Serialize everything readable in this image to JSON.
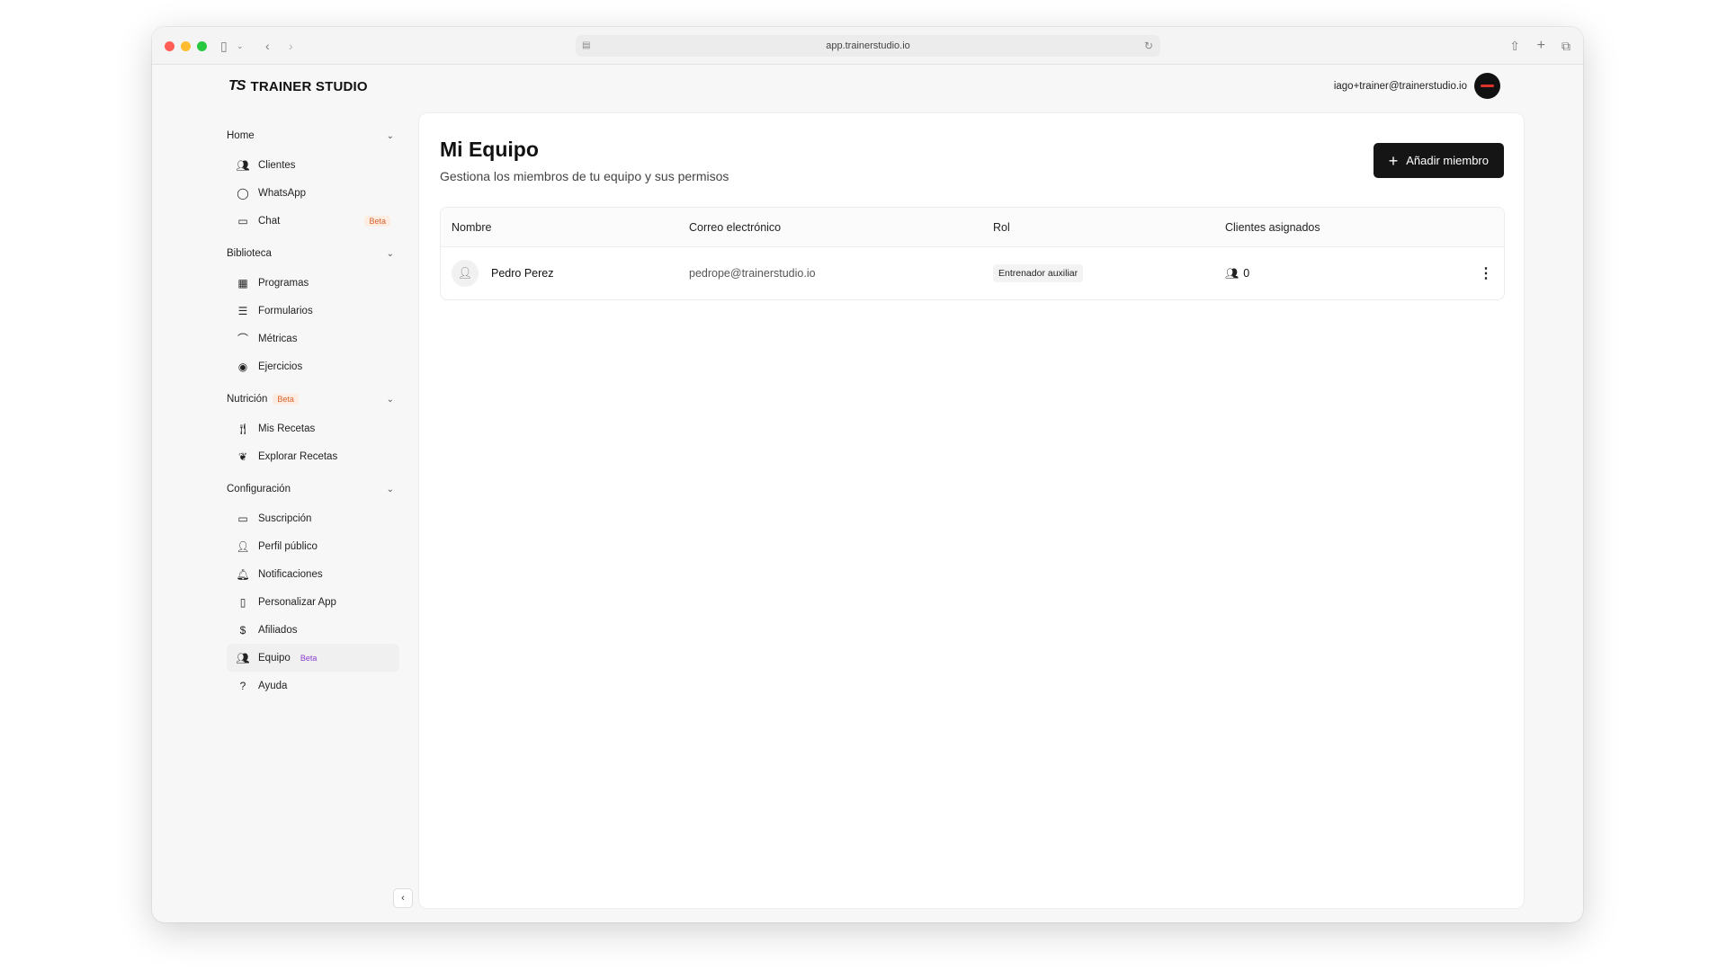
{
  "browser": {
    "url": "app.trainerstudio.io"
  },
  "header": {
    "logo_mark": "TS",
    "logo_text": "TRAINER STUDIO",
    "account_email": "iago+trainer@trainerstudio.io"
  },
  "sidebar": {
    "sections": [
      {
        "title": "Home",
        "items": [
          {
            "label": "Clientes",
            "icon": "users-icon"
          },
          {
            "label": "WhatsApp",
            "icon": "whatsapp-icon"
          },
          {
            "label": "Chat",
            "icon": "chat-icon",
            "badge": "Beta"
          }
        ]
      },
      {
        "title": "Biblioteca",
        "items": [
          {
            "label": "Programas",
            "icon": "calendar-icon"
          },
          {
            "label": "Formularios",
            "icon": "list-icon"
          },
          {
            "label": "Métricas",
            "icon": "chart-icon"
          },
          {
            "label": "Ejercicios",
            "icon": "dumbbell-icon"
          }
        ]
      },
      {
        "title": "Nutrición",
        "badge": "Beta",
        "items": [
          {
            "label": "Mis Recetas",
            "icon": "utensils-icon"
          },
          {
            "label": "Explorar Recetas",
            "icon": "salad-icon"
          }
        ]
      },
      {
        "title": "Configuración",
        "items": [
          {
            "label": "Suscripción",
            "icon": "card-icon"
          },
          {
            "label": "Perfil público",
            "icon": "user-icon"
          },
          {
            "label": "Notificaciones",
            "icon": "bell-icon"
          },
          {
            "label": "Personalizar App",
            "icon": "phone-icon"
          },
          {
            "label": "Afiliados",
            "icon": "dollar-icon"
          },
          {
            "label": "Equipo",
            "icon": "users-icon",
            "badge": "Beta",
            "active": true
          },
          {
            "label": "Ayuda",
            "icon": "help-icon"
          }
        ]
      }
    ]
  },
  "main": {
    "title": "Mi Equipo",
    "subtitle": "Gestiona los miembros de tu equipo y sus permisos",
    "add_button_label": "Añadir miembro",
    "table": {
      "columns": [
        "Nombre",
        "Correo electrónico",
        "Rol",
        "Clientes asignados"
      ],
      "rows": [
        {
          "name": "Pedro Perez",
          "email": "pedrope@trainerstudio.io",
          "role": "Entrenador auxiliar",
          "clients": "0"
        }
      ]
    }
  },
  "colors": {
    "accent": "#151515",
    "beta_orange": "#d9622b",
    "beta_purple": "#8a3fd1"
  }
}
